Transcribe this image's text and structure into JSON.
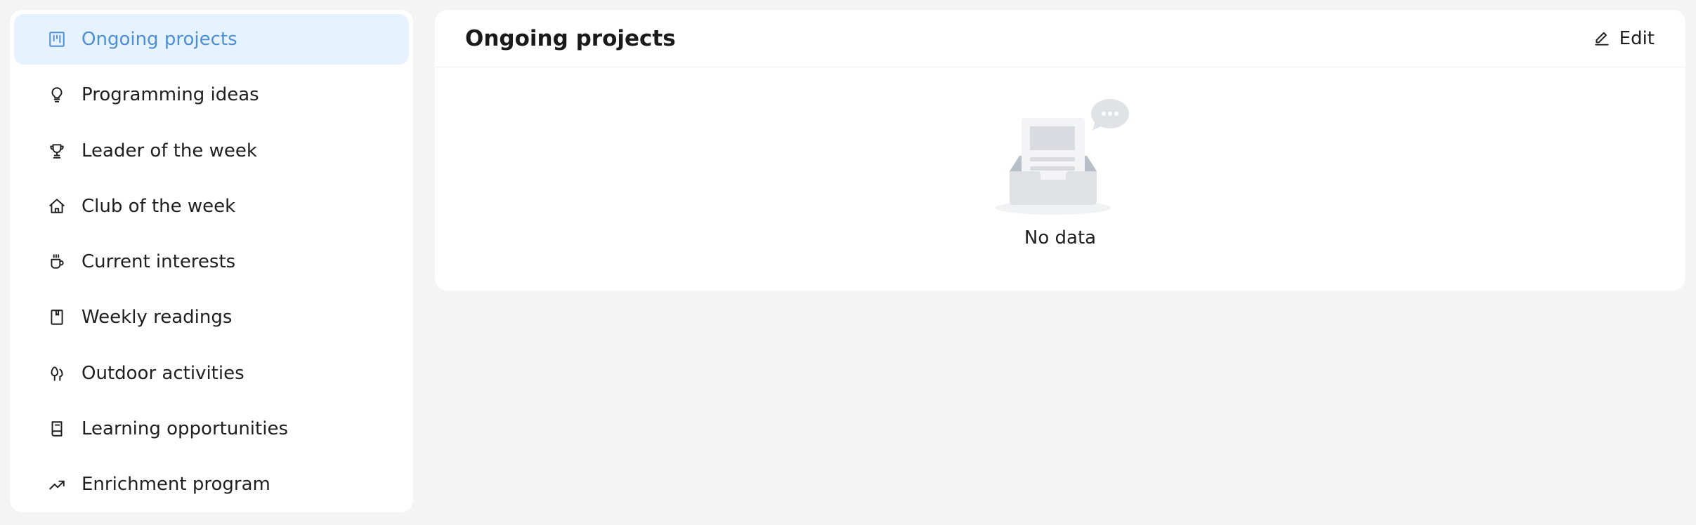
{
  "sidebar": {
    "items": [
      {
        "label": "Ongoing projects",
        "icon": "kanban-board-icon",
        "active": true
      },
      {
        "label": "Programming ideas",
        "icon": "lightbulb-icon",
        "active": false
      },
      {
        "label": "Leader of the week",
        "icon": "trophy-icon",
        "active": false
      },
      {
        "label": "Club of the week",
        "icon": "home-icon",
        "active": false
      },
      {
        "label": "Current interests",
        "icon": "coffee-cup-icon",
        "active": false
      },
      {
        "label": "Weekly readings",
        "icon": "bookmark-icon",
        "active": false
      },
      {
        "label": "Outdoor activities",
        "icon": "trees-icon",
        "active": false
      },
      {
        "label": "Learning opportunities",
        "icon": "book-icon",
        "active": false
      },
      {
        "label": "Enrichment program",
        "icon": "trending-up-icon",
        "active": false
      }
    ]
  },
  "main": {
    "title": "Ongoing projects",
    "edit_label": "Edit",
    "empty_text": "No data"
  },
  "colors": {
    "accent": "#4d8fd6",
    "active_bg": "#e6f2fd",
    "page_bg": "#f4f4f4",
    "card_bg": "#ffffff"
  }
}
